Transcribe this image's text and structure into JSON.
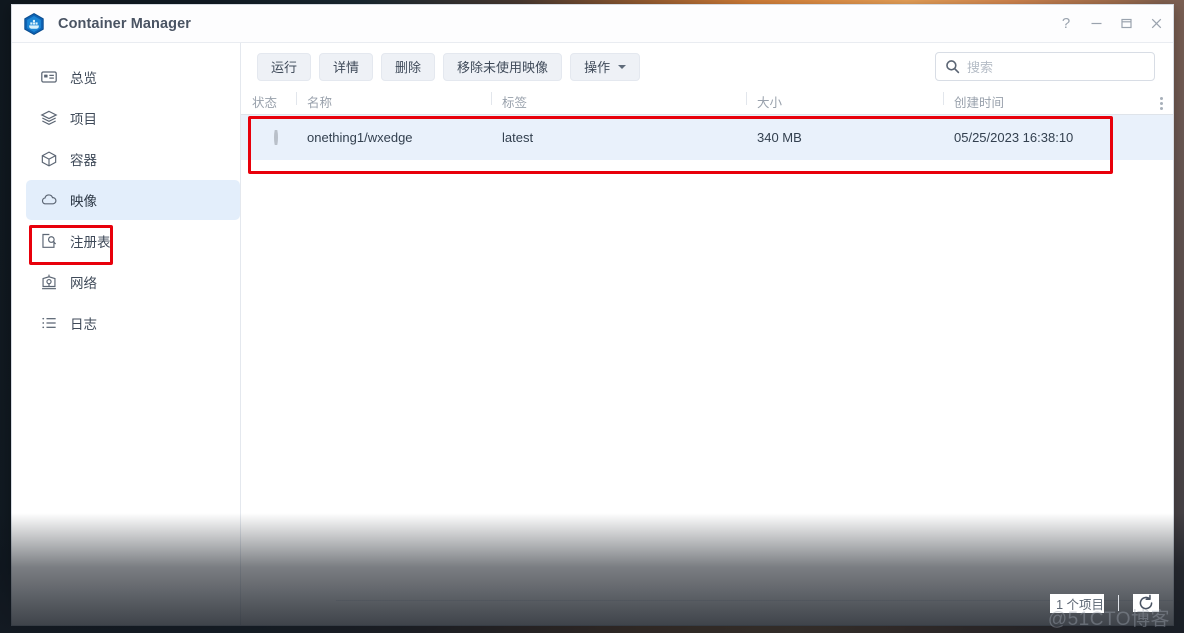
{
  "window": {
    "title": "Container Manager",
    "logo_icon": "container-manager-logo-icon",
    "controls": {
      "help": "?",
      "minimize_icon": "minimize-icon",
      "maximize_icon": "maximize-icon",
      "close_icon": "close-icon"
    }
  },
  "sidebar": {
    "items": [
      {
        "label": "总览",
        "icon": "overview-icon",
        "selected": false
      },
      {
        "label": "项目",
        "icon": "layers-icon",
        "selected": false
      },
      {
        "label": "容器",
        "icon": "cube-icon",
        "selected": false
      },
      {
        "label": "映像",
        "icon": "cloud-icon",
        "selected": true
      },
      {
        "label": "注册表",
        "icon": "registry-icon",
        "selected": false
      },
      {
        "label": "网络",
        "icon": "network-icon",
        "selected": false
      },
      {
        "label": "日志",
        "icon": "log-list-icon",
        "selected": false
      }
    ]
  },
  "toolbar": {
    "run_label": "运行",
    "details_label": "详情",
    "delete_label": "删除",
    "remove_unused_label": "移除未使用映像",
    "actions_label": "操作"
  },
  "search": {
    "placeholder": "搜索",
    "value": "",
    "icon": "search-icon"
  },
  "table": {
    "columns": [
      {
        "key": "status",
        "label": "状态"
      },
      {
        "key": "name",
        "label": "名称"
      },
      {
        "key": "tag",
        "label": "标签"
      },
      {
        "key": "size",
        "label": "大小"
      },
      {
        "key": "time",
        "label": "创建时间"
      }
    ],
    "column_menu_icon": "column-options-kebab-icon",
    "rows": [
      {
        "status": "stopped",
        "status_icon": "status-circle-icon",
        "name": "onething1/wxedge",
        "tag": "latest",
        "size": "340 MB",
        "time": "05/25/2023 16:38:10",
        "selected": true
      }
    ]
  },
  "footer": {
    "count_text": "1 个项目",
    "refresh_icon": "refresh-icon"
  },
  "watermark": {
    "text": "@51CTO博客"
  },
  "colors": {
    "accent": "#2a7ad6",
    "selection_bg": "#e9f1fb",
    "sidebar_selection_bg": "#e3eefb",
    "annotation_red": "#e8000b",
    "toolbar_button_bg": "#eef1f6",
    "text_primary": "#33404f",
    "text_muted": "#99a1ac"
  },
  "annotations": [
    {
      "name": "sidebar-images-highlight",
      "color": "#e8000b"
    },
    {
      "name": "image-row-highlight",
      "color": "#e8000b"
    }
  ]
}
